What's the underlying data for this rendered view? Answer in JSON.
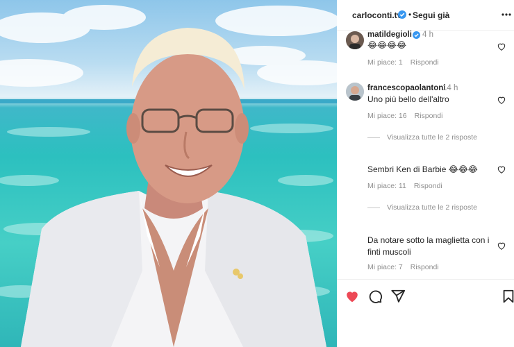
{
  "header": {
    "username": "carloconti.tv",
    "separator": "•",
    "follow_label": "Segui già"
  },
  "comments": [
    {
      "username": "matildegioli",
      "verified": true,
      "time": "4 h",
      "text": "😂😂😂😂",
      "likes": "Mi piace: 1",
      "reply_label": "Rispondi"
    },
    {
      "username": "francescopaolantoni",
      "time": "14 h",
      "text": "Uno più bello dell'altro",
      "likes": "Mi piace: 16",
      "reply_label": "Rispondi",
      "view_replies": "Visualizza tutte le 2 risposte"
    },
    {
      "text": "Sembri Ken di Barbie 😂😂😂",
      "likes": "Mi piace: 11",
      "reply_label": "Rispondi",
      "view_replies": "Visualizza tutte le 2 risposte"
    },
    {
      "text": "Da notare sotto la maglietta con i finti muscoli",
      "likes": "Mi piace: 7",
      "reply_label": "Rispondi"
    }
  ],
  "actions": {
    "like_icon": "heart-filled-icon",
    "comment_icon": "comment-icon",
    "share_icon": "share-icon",
    "save_icon": "bookmark-icon"
  },
  "colors": {
    "like_red": "#ed4956",
    "verified_blue": "#3897f0",
    "muted_text": "#8e8e8e"
  }
}
